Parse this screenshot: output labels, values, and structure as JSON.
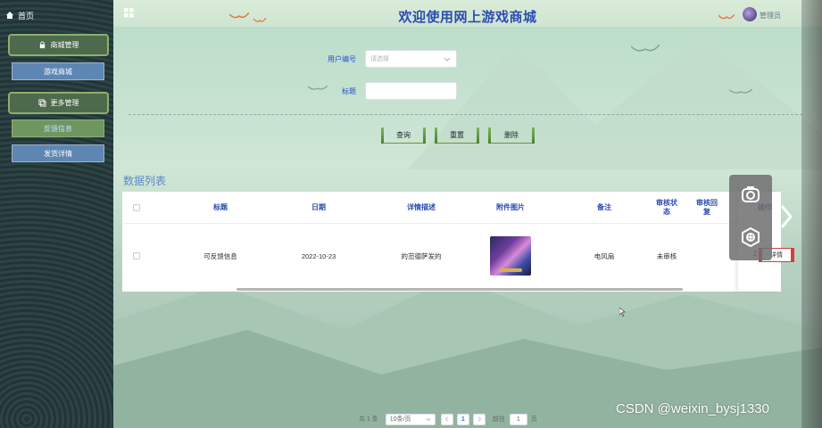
{
  "sidebar": {
    "home_label": "首页",
    "menus": [
      {
        "label": "商城管理",
        "icon": "lock-icon"
      },
      {
        "label": "更多管理",
        "icon": "copy-icon"
      }
    ],
    "sub_items": [
      {
        "label": "游戏商城",
        "active": false
      },
      {
        "label": "反馈信息",
        "active": true
      },
      {
        "label": "发货详情",
        "active": false
      }
    ]
  },
  "header": {
    "title": "欢迎使用网上游戏商城",
    "user_name": "管理员"
  },
  "filters": {
    "user_no_label": "用户编号",
    "user_no_placeholder": "请选择",
    "title_label": "标题",
    "title_value": ""
  },
  "actions": {
    "query": "查询",
    "reset": "重置",
    "delete": "删除"
  },
  "list": {
    "section_title": "数据列表",
    "columns": [
      "标题",
      "日期",
      "详情描述",
      "附件图片",
      "备注",
      "审核状态",
      "审核回复",
      "操作"
    ],
    "rows": [
      {
        "title": "可反馈信息",
        "date": "2022-10-23",
        "description": "的范德萨发的",
        "image": "game-art",
        "remark": "电风扇",
        "status": "未审核",
        "reply": "2",
        "action": "详情"
      }
    ]
  },
  "pagination": {
    "total": "共 1 条",
    "page_size": "10条/页",
    "current_page": "1",
    "goto_label": "前往",
    "goto_value": "1",
    "page_suffix": "页"
  },
  "watermark": "CSDN @weixin_bysj1330",
  "colors": {
    "title": "#2b4cb0",
    "sidebar": "#27393b",
    "accent_green": "#6f9661",
    "sub_blue": "#5d86b3"
  }
}
